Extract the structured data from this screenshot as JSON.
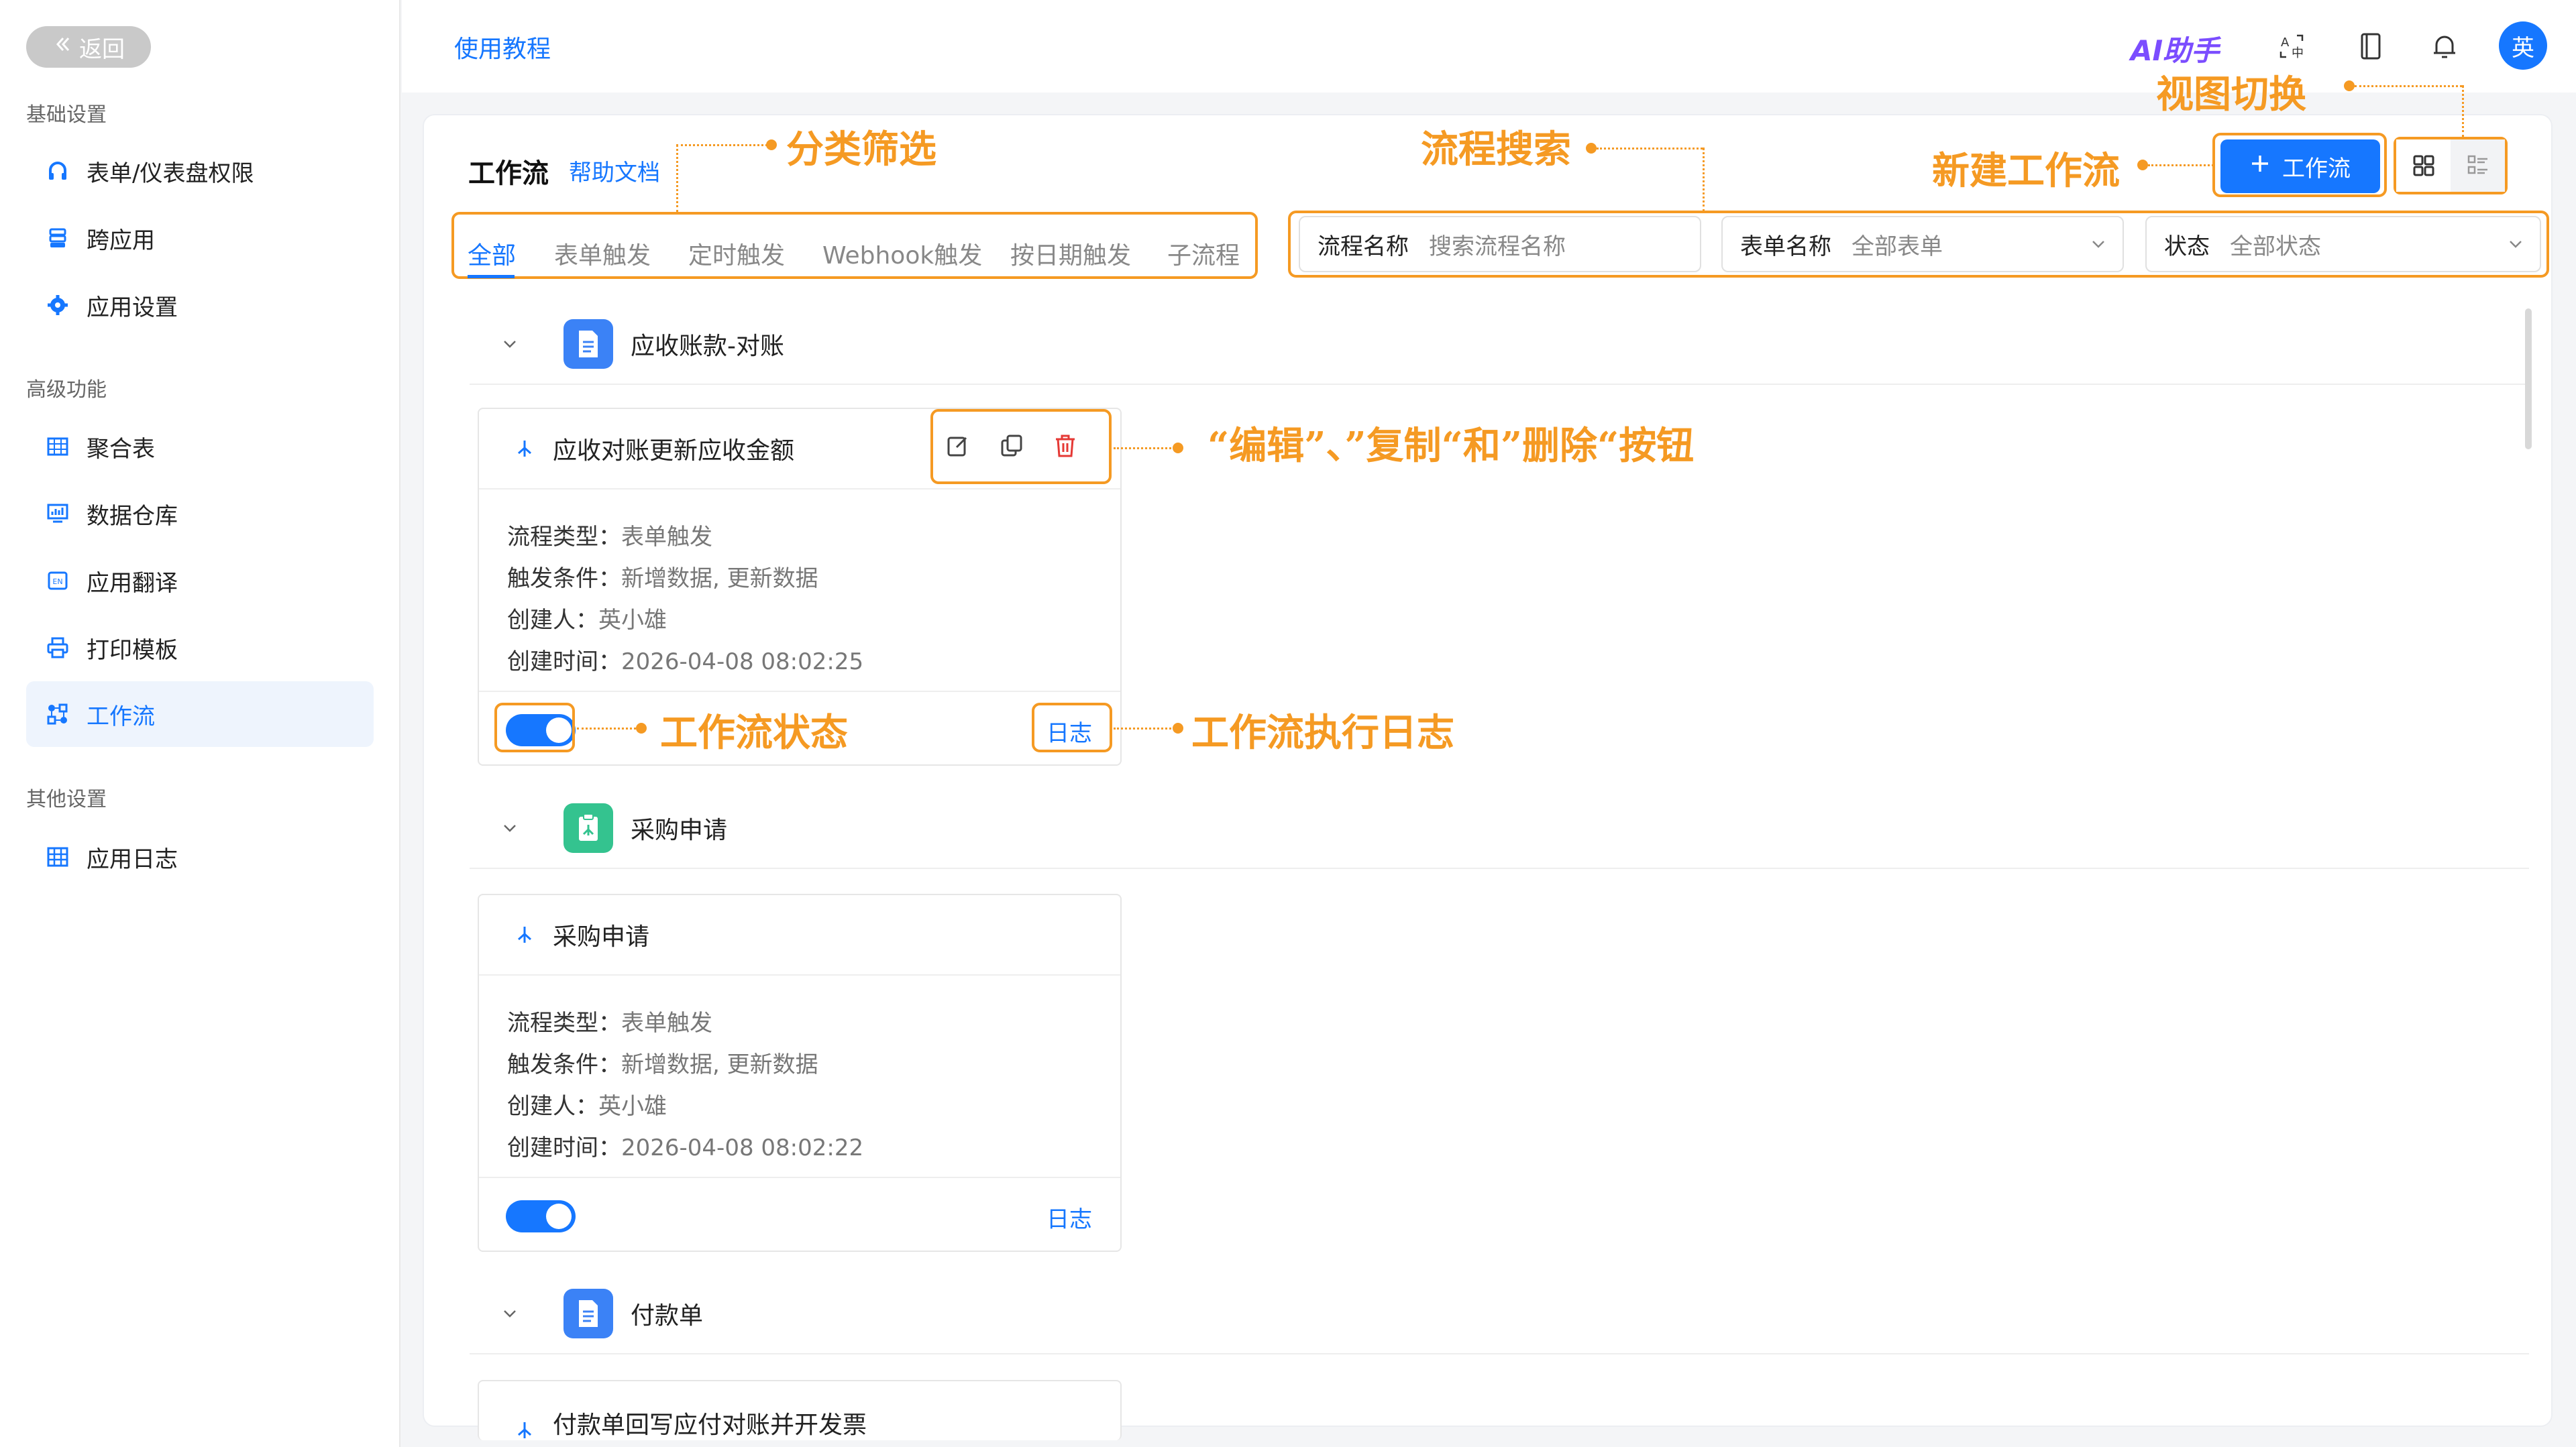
{
  "sidebar": {
    "back_label": "返回",
    "sections": [
      {
        "title": "基础设置",
        "items": [
          {
            "label": "表单/仪表盘权限",
            "icon": "headset-icon"
          },
          {
            "label": "跨应用",
            "icon": "stack-icon"
          },
          {
            "label": "应用设置",
            "icon": "gear-icon"
          }
        ]
      },
      {
        "title": "高级功能",
        "items": [
          {
            "label": "聚合表",
            "icon": "table-icon"
          },
          {
            "label": "数据仓库",
            "icon": "warehouse-icon"
          },
          {
            "label": "应用翻译",
            "icon": "translate-icon"
          },
          {
            "label": "打印模板",
            "icon": "printer-icon"
          },
          {
            "label": "工作流",
            "icon": "workflow-icon",
            "active": true
          }
        ]
      },
      {
        "title": "其他设置",
        "items": [
          {
            "label": "应用日志",
            "icon": "grid-icon"
          }
        ]
      }
    ]
  },
  "topbar": {
    "tutorial_link": "使用教程",
    "ai_assistant": "AI助手",
    "avatar_text": "英"
  },
  "page": {
    "title": "工作流",
    "help_link": "帮助文档",
    "tabs": [
      "全部",
      "表单触发",
      "定时触发",
      "Webhook触发",
      "按日期触发",
      "子流程"
    ],
    "active_tab": "全部",
    "search": {
      "flow_name_label": "流程名称",
      "flow_name_placeholder": "搜索流程名称",
      "form_name_label": "表单名称",
      "form_name_value": "全部表单",
      "status_label": "状态",
      "status_value": "全部状态"
    },
    "new_button_label": "工作流",
    "accent_color": "#1677ff",
    "annotation_color": "#f59a23"
  },
  "groups": [
    {
      "name": "应收账款-对账",
      "icon_color": "#3b82f6"
    },
    {
      "name": "采购申请",
      "icon_color": "#34c38f"
    },
    {
      "name": "付款单",
      "icon_color": "#3b82f6"
    }
  ],
  "cards": [
    {
      "name": "应收对账更新应收金额",
      "type_label": "流程类型：",
      "type_value": "表单触发",
      "trigger_label": "触发条件：",
      "trigger_value": "新增数据, 更新数据",
      "creator_label": "创建人：",
      "creator_value": "英小雄",
      "time_label": "创建时间：",
      "time_value": "2026-04-08 08:02:25",
      "log_label": "日志",
      "enabled": true
    },
    {
      "name": "采购申请",
      "type_label": "流程类型：",
      "type_value": "表单触发",
      "trigger_label": "触发条件：",
      "trigger_value": "新增数据, 更新数据",
      "creator_label": "创建人：",
      "creator_value": "英小雄",
      "time_label": "创建时间：",
      "time_value": "2026-04-08 08:02:22",
      "log_label": "日志",
      "enabled": true
    },
    {
      "name": "付款单回写应付对账并开发票"
    }
  ],
  "callouts": {
    "category_filter": "分类筛选",
    "flow_search": "流程搜索",
    "new_workflow": "新建工作流",
    "view_switch": "视图切换",
    "card_buttons": "“编辑”、”复制“和”删除“按钮",
    "workflow_status": "工作流状态",
    "workflow_log": "工作流执行日志"
  }
}
